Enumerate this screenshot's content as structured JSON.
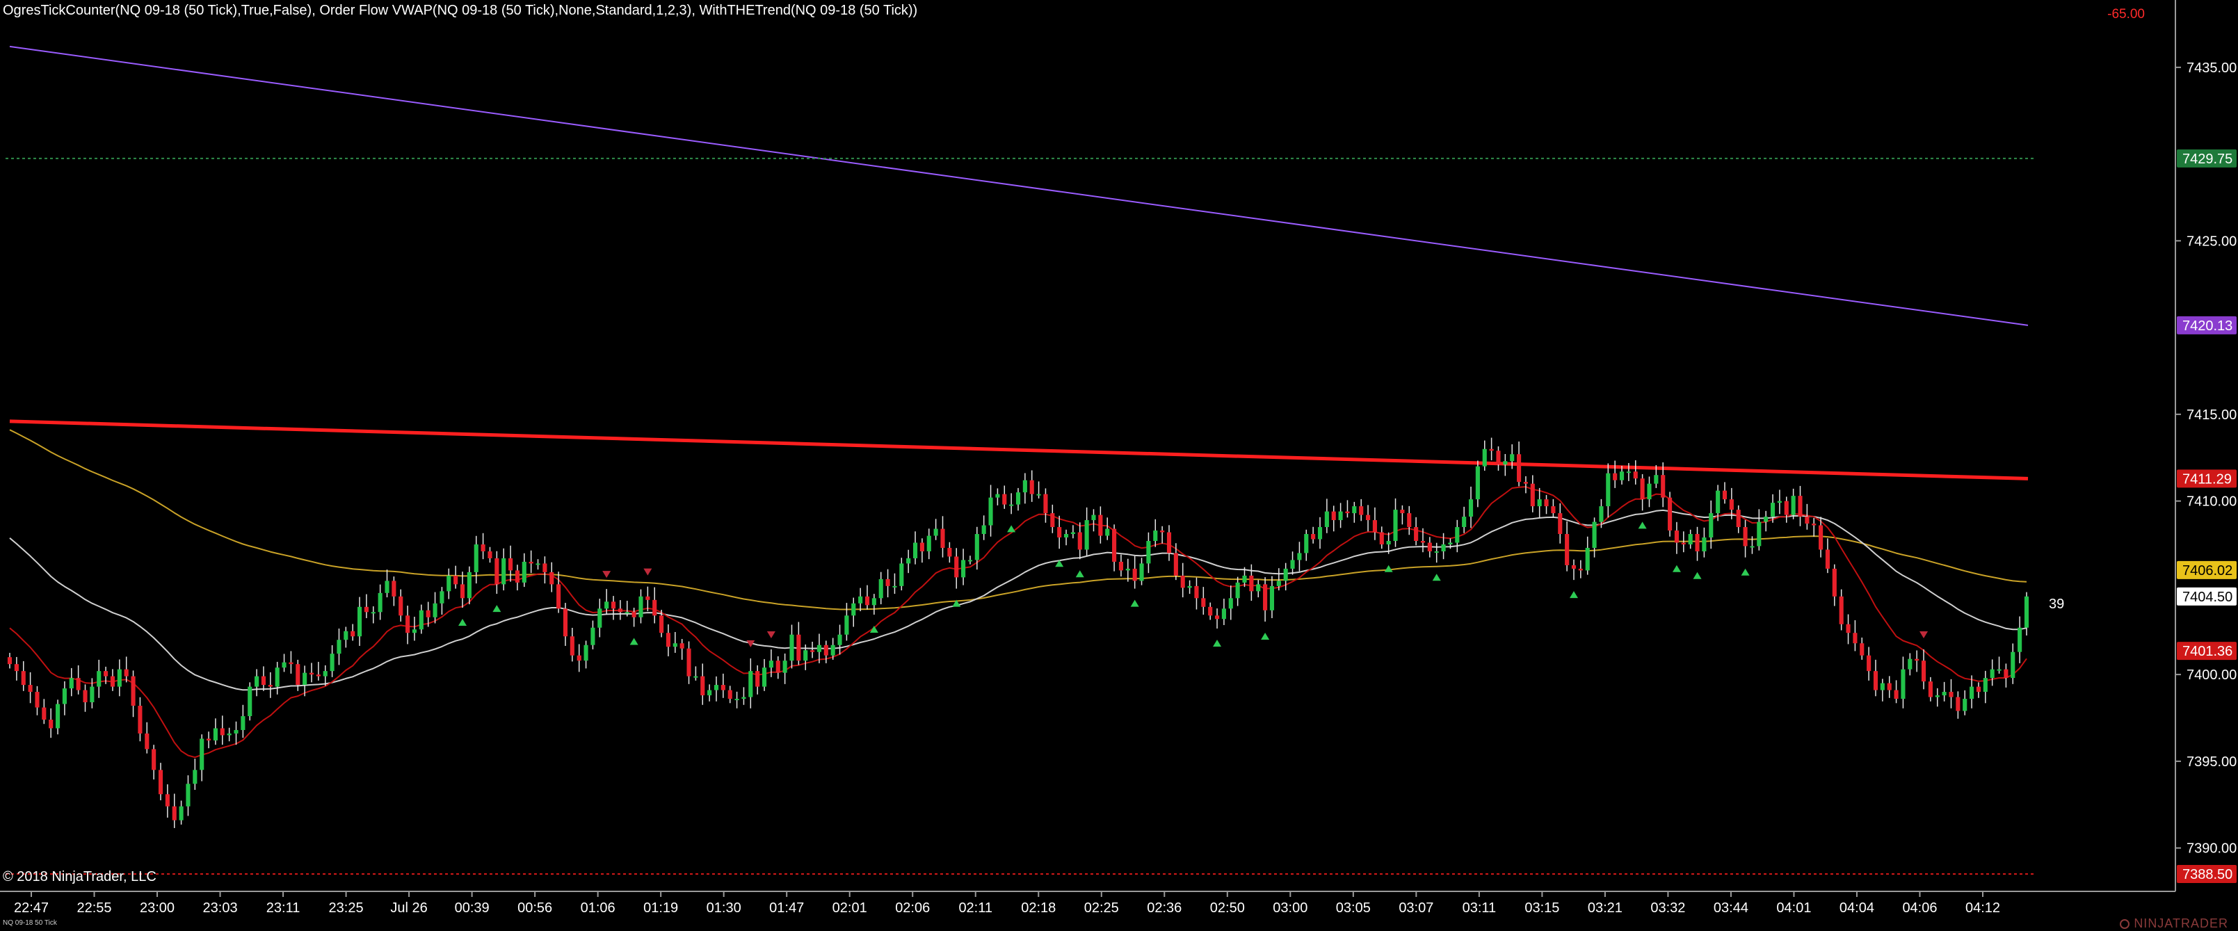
{
  "header": {
    "indicators": "OgresTickCounter(NQ 09-18 (50 Tick),True,False), Order Flow VWAP(NQ 09-18 (50 Tick),None,Standard,1,2,3), WithTHETrend(NQ 09-18 (50 Tick))",
    "pnl": "-65.00"
  },
  "footer": {
    "copyright": "© 2018 NinjaTrader, LLC",
    "instrument": "NQ 09-18 50 Tick",
    "brand": "NINJATRADER"
  },
  "tick_counter": "39",
  "colors": {
    "background": "#000000",
    "up_candle": "#22c34a",
    "down_candle": "#e8202a",
    "vwap": "#ff1f1f",
    "band_upper": "#9a5cff",
    "ema_slow": "#c9a227",
    "ema_mid": "#d0d0d0",
    "ema_fast": "#c01010"
  },
  "chart_data": {
    "type": "candlestick",
    "yaxis": {
      "range": [
        7387.5,
        7438.0
      ],
      "ticks": [
        "7435.00",
        "7425.00",
        "7415.00",
        "7410.00",
        "7400.00",
        "7395.00",
        "7390.00"
      ],
      "tick_values": [
        7435,
        7425,
        7415,
        7410,
        7400,
        7395,
        7390
      ]
    },
    "xaxis": {
      "labels": [
        "22:47",
        "22:55",
        "23:00",
        "23:03",
        "23:11",
        "23:25",
        "Jul 26",
        "00:39",
        "00:56",
        "01:06",
        "01:19",
        "01:30",
        "01:47",
        "02:01",
        "02:06",
        "02:11",
        "02:18",
        "02:25",
        "02:36",
        "02:50",
        "03:00",
        "03:05",
        "03:07",
        "03:11",
        "03:15",
        "03:21",
        "03:32",
        "03:44",
        "04:01",
        "04:04",
        "04:06",
        "04:12"
      ]
    },
    "price_markers": [
      {
        "value": "7429.75",
        "color": "#1e7a3a"
      },
      {
        "value": "7420.13",
        "color": "#8a3ccf"
      },
      {
        "value": "7411.29",
        "color": "#d01818"
      },
      {
        "value": "7406.02",
        "color": "#e8c21a"
      },
      {
        "value": "7404.50",
        "color": "#ffffff"
      },
      {
        "value": "7401.36",
        "color": "#d01818"
      },
      {
        "value": "7388.50",
        "color": "#d01818"
      }
    ],
    "horizontal_lines": [
      {
        "value": 7429.75,
        "color": "#2e8b4a"
      },
      {
        "value": 7388.5,
        "color": "#d01818"
      }
    ],
    "close": [
      7400.6,
      7400.2,
      7399.4,
      7399.0,
      7398.1,
      7397.4,
      7396.9,
      7398.3,
      7399.2,
      7399.8,
      7399.1,
      7398.4,
      7399.3,
      7400.2,
      7399.9,
      7399.3,
      7400.3,
      7399.9,
      7398.2,
      7396.6,
      7395.7,
      7394.5,
      7393.1,
      7392.4,
      7391.6,
      7392.4,
      7393.7,
      7394.5,
      7396.3,
      7396.2,
      7396.9,
      7396.5,
      7396.6,
      7396.8,
      7397.6,
      7399.3,
      7399.9,
      7399.4,
      7399.3,
      7400.4,
      7400.7,
      7400.6,
      7399.4,
      7400.1,
      7400.0,
      7399.9,
      7400.2,
      7401.2,
      7402.0,
      7402.5,
      7402.2,
      7403.9,
      7403.6,
      7403.6,
      7404.7,
      7405.4,
      7404.5,
      7403.4,
      7402.4,
      7402.6,
      7403.7,
      7403.3,
      7404.1,
      7404.8,
      7405.7,
      7405.2,
      7404.4,
      7405.9,
      7407.5,
      7407.1,
      7406.7,
      7405.2,
      7406.7,
      7406.0,
      7405.3,
      7406.5,
      7406.4,
      7406.4,
      7405.9,
      7405.2,
      7403.8,
      7402.2,
      7401.1,
      7400.8,
      7401.7,
      7402.7,
      7403.8,
      7404.2,
      7403.8,
      7403.6,
      7403.6,
      7403.3,
      7404.5,
      7404.3,
      7403.4,
      7402.4,
      7401.6,
      7401.8,
      7401.5,
      7399.9,
      7399.9,
      7398.8,
      7399.1,
      7399.4,
      7399.1,
      7398.6,
      7398.6,
      7398.7,
      7400.2,
      7399.3,
      7400.4,
      7400.8,
      7400.1,
      7400.8,
      7402.3,
      7400.8,
      7401.4,
      7401.3,
      7401.7,
      7401.1,
      7401.7,
      7402.3,
      7403.4,
      7404.1,
      7404.5,
      7404.0,
      7404.4,
      7405.5,
      7405.1,
      7405.1,
      7406.4,
      7406.7,
      7407.6,
      7407.1,
      7408.0,
      7408.4,
      7407.3,
      7406.8,
      7405.6,
      7406.6,
      7406.6,
      7408.1,
      7408.6,
      7410.2,
      7410.4,
      7409.8,
      7409.8,
      7410.5,
      7411.2,
      7410.4,
      7410.4,
      7409.3,
      7408.5,
      7407.9,
      7408.1,
      7408.2,
      7407.2,
      7408.9,
      7409.2,
      7408.0,
      7408.4,
      7406.5,
      7406.0,
      7406.1,
      7405.4,
      7406.4,
      7407.7,
      7408.3,
      7408.2,
      7407.0,
      7405.7,
      7405.0,
      7405.1,
      7404.4,
      7403.9,
      7403.4,
      7403.2,
      7403.8,
      7404.4,
      7405.3,
      7405.7,
      7404.8,
      7405.2,
      7403.7,
      7405.1,
      7405.4,
      7406.1,
      7406.6,
      7407.0,
      7408.1,
      7407.8,
      7408.5,
      7409.4,
      7408.9,
      7409.4,
      7409.3,
      7409.7,
      7409.2,
      7408.9,
      7408.2,
      7407.5,
      7407.7,
      7409.5,
      7409.3,
      7408.5,
      7407.7,
      7407.6,
      7407.1,
      7407.1,
      7407.5,
      7407.6,
      7408.5,
      7409.1,
      7410.1,
      7412.0,
      7413.0,
      7412.9,
      7412.1,
      7412.3,
      7412.7,
      7411.1,
      7411.0,
      7409.7,
      7410.1,
      7409.7,
      7409.3,
      7408.1,
      7406.3,
      7406.1,
      7406.0,
      7407.3,
      7408.8,
      7409.7,
      7411.6,
      7411.2,
      7411.7,
      7411.7,
      7411.3,
      7410.1,
      7411.0,
      7411.5,
      7410.2,
      7408.3,
      7407.6,
      7407.5,
      7408.1,
      7407.1,
      7407.9,
      7409.3,
      7410.6,
      7410.1,
      7409.5,
      7408.5,
      7407.4,
      7407.4,
      7408.8,
      7409.1,
      7409.9,
      7410.0,
      7409.2,
      7410.3,
      7409.1,
      7408.7,
      7408.6,
      7407.2,
      7406.1,
      7404.5,
      7402.9,
      7402.4,
      7401.8,
      7401.1,
      7400.2,
      7399.1,
      7399.5,
      7399.1,
      7398.6,
      7400.3,
      7400.9,
      7400.8,
      7399.6,
      7398.7,
      7398.8,
      7399.0,
      7398.7,
      7397.9,
      7398.6,
      7399.3,
      7399.0,
      7399.8,
      7400.3,
      7400.3,
      7399.8,
      7401.3,
      7402.7,
      7404.5
    ]
  }
}
